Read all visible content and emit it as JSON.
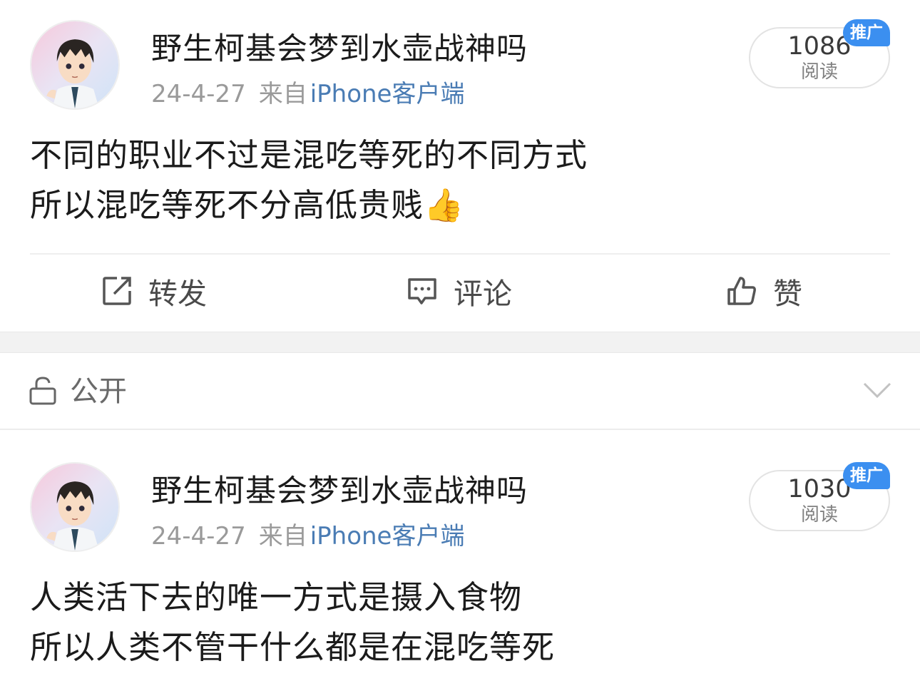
{
  "posts": [
    {
      "username": "野生柯基会梦到水壶战神吗",
      "date": "24-4-27",
      "from": "来自",
      "client": "iPhone客户端",
      "read_count": "1086",
      "read_label": "阅读",
      "badge": "推广",
      "lines": [
        "不同的职业不过是混吃等死的不同方式",
        "所以混吃等死不分高低贵贱👍"
      ]
    },
    {
      "username": "野生柯基会梦到水壶战神吗",
      "date": "24-4-27",
      "from": "来自",
      "client": "iPhone客户端",
      "read_count": "1030",
      "read_label": "阅读",
      "badge": "推广",
      "lines": [
        "人类活下去的唯一方式是摄入食物",
        "所以人类不管干什么都是在混吃等死"
      ]
    }
  ],
  "actions": {
    "repost_label": "转发",
    "comment_label": "评论",
    "like_label": "赞"
  },
  "visibility": {
    "label": "公开"
  },
  "icons": {
    "repost": "share-edit-icon",
    "comment": "comment-icon",
    "like": "thumbs-up-icon",
    "lock": "unlock-icon",
    "expand": "chevron-down-icon"
  },
  "colors": {
    "client_link": "#4a7cb4",
    "badge": "#3b8ff0",
    "separator": "#f2f2f2"
  }
}
